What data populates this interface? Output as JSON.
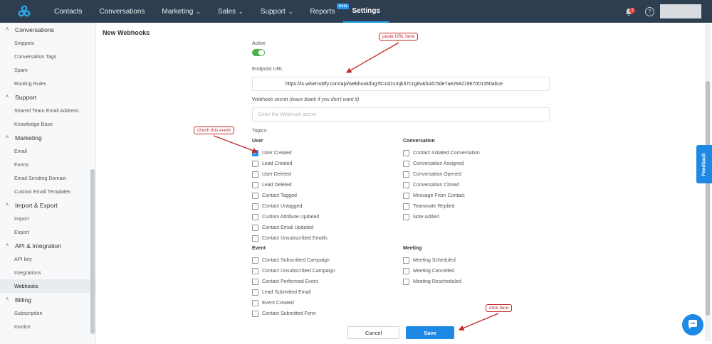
{
  "nav": {
    "items": [
      {
        "label": "Contacts",
        "has_chevron": false
      },
      {
        "label": "Conversations",
        "has_chevron": false
      },
      {
        "label": "Marketing",
        "has_chevron": true
      },
      {
        "label": "Sales",
        "has_chevron": true
      },
      {
        "label": "Support",
        "has_chevron": true
      },
      {
        "label": "Reports",
        "badge": "beta"
      },
      {
        "label": "Settings",
        "active": true
      }
    ],
    "notification_count": "3",
    "help_glyph": "?"
  },
  "sidebar": {
    "sections": [
      {
        "title": "Conversations",
        "items": [
          "Snippets",
          "Conversation Tags",
          "Spam",
          "Routing Rules"
        ]
      },
      {
        "title": "Support",
        "items": [
          "Shared Team Email Address",
          "Knowledge Base"
        ]
      },
      {
        "title": "Marketing",
        "items": [
          "Email",
          "Forms",
          "Email Sending Domain",
          "Custom Email Templates"
        ]
      },
      {
        "title": "Import & Export",
        "items": [
          "Import",
          "Export"
        ]
      },
      {
        "title": "API & Integration",
        "items": [
          "API key",
          "Integrations",
          "Webhooks"
        ]
      },
      {
        "title": "Billing",
        "items": [
          "Subscription",
          "Invoice"
        ]
      }
    ],
    "selected": "Webhooks"
  },
  "page": {
    "title": "New Webhooks",
    "active_label": "Active",
    "active_on": true,
    "endpoint_label": "Endpoint URL",
    "endpoint_value": "https://is.wisernotify.com/api/webhook/log?ti=cd1smjk37c1g6v&fuid=5de7ae29421967001350abce",
    "secret_label": "Webhook secret",
    "secret_hint": "(leave blank if you don't want it)",
    "secret_placeholder": "Enter the Webhook secret",
    "topics_label": "Topics:",
    "groups": {
      "user": {
        "title": "User",
        "options": [
          {
            "label": "User Created",
            "checked": true
          },
          {
            "label": "Lead Created",
            "checked": false
          },
          {
            "label": "User Deleted",
            "checked": false
          },
          {
            "label": "Lead Deleted",
            "checked": false
          },
          {
            "label": "Contact Tagged",
            "checked": false
          },
          {
            "label": "Contact Untagged",
            "checked": false
          },
          {
            "label": "Custom Attribute Updated",
            "checked": false
          },
          {
            "label": "Contact Email Updated",
            "checked": false
          },
          {
            "label": "Contact Unsubscribed Emails",
            "checked": false
          }
        ]
      },
      "conversation": {
        "title": "Conversation",
        "options": [
          {
            "label": "Contact Initiated Conversation",
            "checked": false
          },
          {
            "label": "Conversation Assigned",
            "checked": false
          },
          {
            "label": "Conversation Opened",
            "checked": false
          },
          {
            "label": "Conversation Closed",
            "checked": false
          },
          {
            "label": "Message From Contact",
            "checked": false
          },
          {
            "label": "Teammate Replied",
            "checked": false
          },
          {
            "label": "Note Added",
            "checked": false
          }
        ]
      },
      "event": {
        "title": "Event",
        "options": [
          {
            "label": "Contact Subscribed Campaign",
            "checked": false
          },
          {
            "label": "Contact Unsubscribed Campaign",
            "checked": false
          },
          {
            "label": "Contact Performed Event",
            "checked": false
          },
          {
            "label": "Lead Submitted Email",
            "checked": false
          },
          {
            "label": "Event Created",
            "checked": false
          },
          {
            "label": "Contact Submitted Form",
            "checked": false
          }
        ]
      },
      "meeting": {
        "title": "Meeting",
        "options": [
          {
            "label": "Meeting Scheduled",
            "checked": false
          },
          {
            "label": "Meeting Cancelled",
            "checked": false
          },
          {
            "label": "Meeting Rescheduled",
            "checked": false
          }
        ]
      }
    },
    "cancel_label": "Cancel",
    "save_label": "Save"
  },
  "annotations": {
    "paste_url": "paste URL here",
    "check_event": "chech this event",
    "click_here": "click here"
  },
  "feedback_label": "Feedback",
  "colors": {
    "nav_bg": "#2d3e50",
    "primary": "#1e88e5",
    "toggle_on": "#4caf50",
    "annotation": "#c62828"
  }
}
